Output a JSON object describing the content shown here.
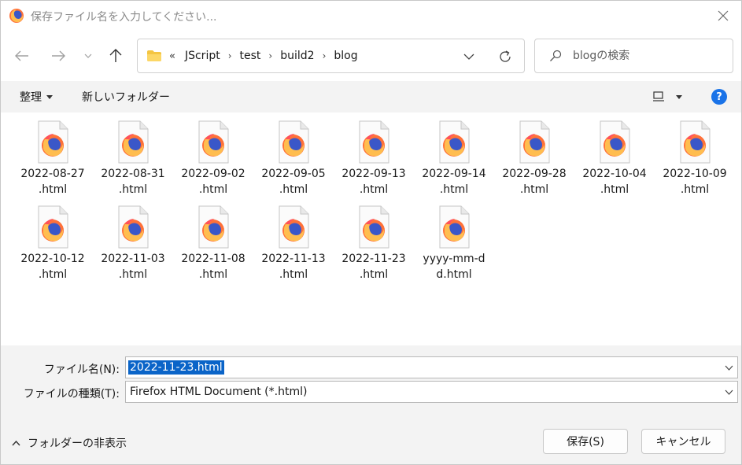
{
  "window": {
    "title": "保存ファイル名を入力してください..."
  },
  "breadcrumb": {
    "prefix": "«",
    "items": [
      "JScript",
      "test",
      "build2",
      "blog"
    ]
  },
  "search": {
    "placeholder": "blogの検索"
  },
  "commands": {
    "organize": "整理",
    "new_folder": "新しいフォルダー",
    "help": "?"
  },
  "files": [
    {
      "line1": "2022-08-27",
      "line2": ".html"
    },
    {
      "line1": "2022-08-31",
      "line2": ".html"
    },
    {
      "line1": "2022-09-02",
      "line2": ".html"
    },
    {
      "line1": "2022-09-05",
      "line2": ".html"
    },
    {
      "line1": "2022-09-13",
      "line2": ".html"
    },
    {
      "line1": "2022-09-14",
      "line2": ".html"
    },
    {
      "line1": "2022-09-28",
      "line2": ".html"
    },
    {
      "line1": "2022-10-04",
      "line2": ".html"
    },
    {
      "line1": "2022-10-09",
      "line2": ".html"
    },
    {
      "line1": "2022-10-12",
      "line2": ".html"
    },
    {
      "line1": "2022-11-03",
      "line2": ".html"
    },
    {
      "line1": "2022-11-08",
      "line2": ".html"
    },
    {
      "line1": "2022-11-13",
      "line2": ".html"
    },
    {
      "line1": "2022-11-23",
      "line2": ".html"
    },
    {
      "line1": "yyyy-mm-d",
      "line2": "d.html"
    }
  ],
  "form": {
    "filename_label": "ファイル名(N):",
    "filename_value": "2022-11-23.html",
    "filetype_label": "ファイルの種類(T):",
    "filetype_value": "Firefox HTML Document (*.html)"
  },
  "footer": {
    "hide_folders": "フォルダーの非表示",
    "save_button": "保存(S)",
    "cancel_button": "キャンセル"
  },
  "colors": {
    "accent": "#0a64c8",
    "help": "#1a73e8",
    "folder": "#f4c542"
  },
  "icons": {
    "app": "firefox-icon",
    "file": "firefox-html-file-icon"
  }
}
